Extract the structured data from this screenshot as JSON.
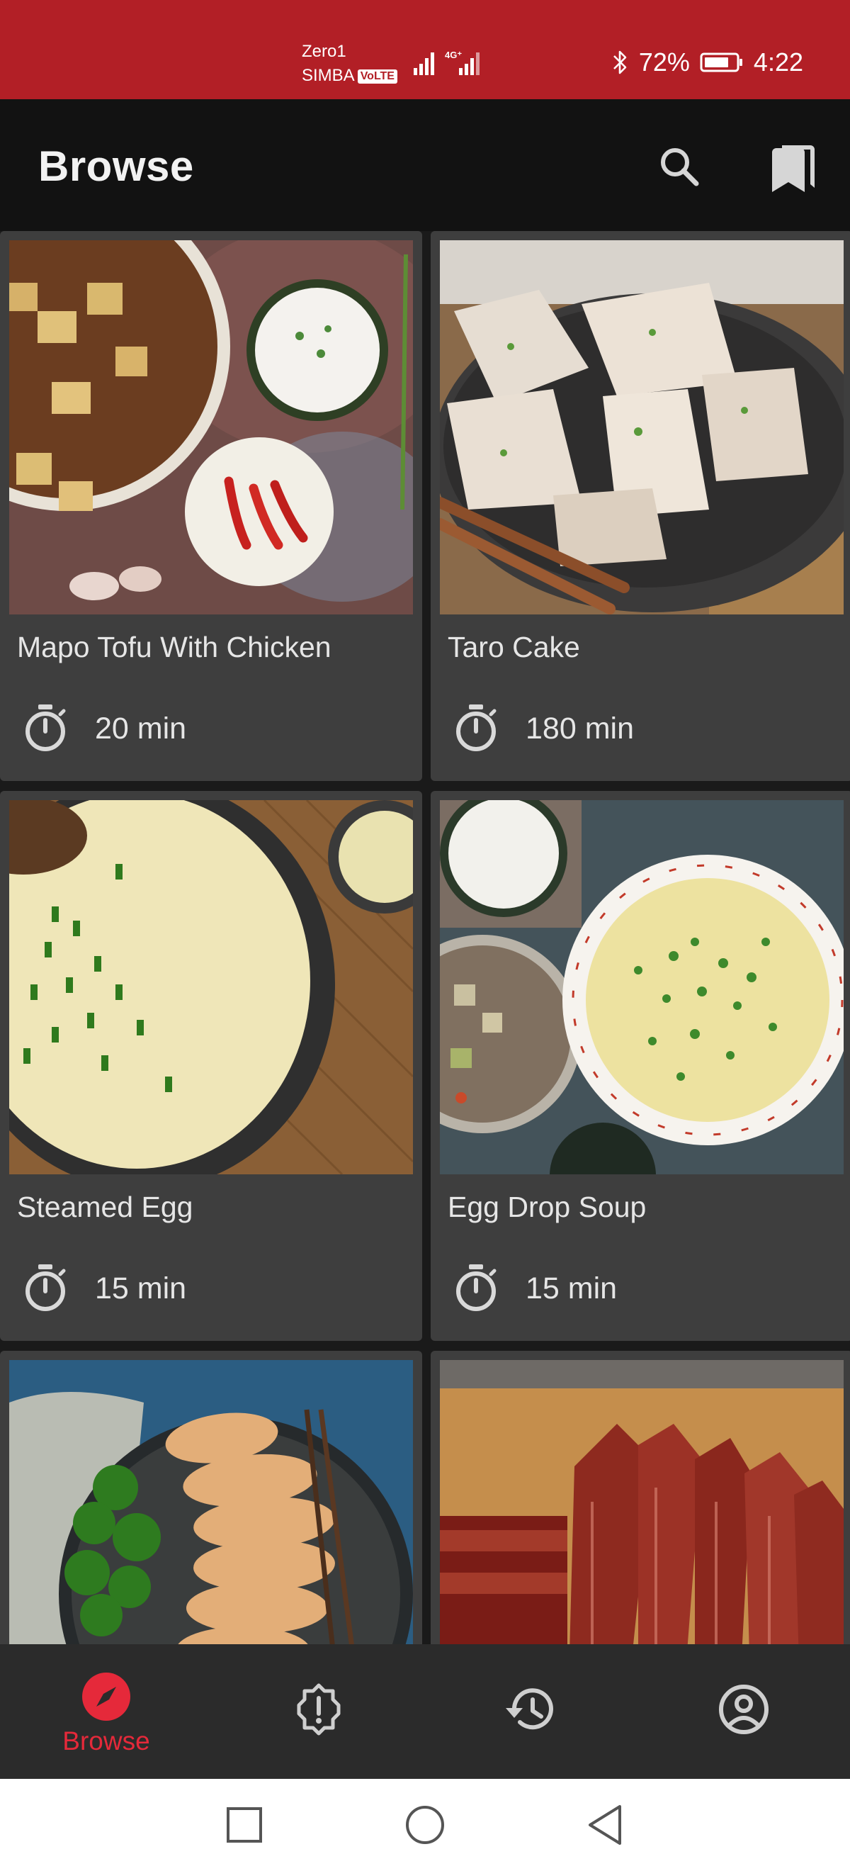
{
  "status_bar": {
    "carrier_line1": "Zero1",
    "carrier_line2": "SIMBA",
    "volte": "VoLTE",
    "network": "4G⁺",
    "battery": "72%",
    "time": "4:22",
    "bg_color": "#b21f26"
  },
  "app_bar": {
    "title": "Browse",
    "search_icon": "search-icon",
    "bookmarks_icon": "bookmarks-icon"
  },
  "recipes": [
    {
      "name": "Mapo Tofu With Chicken",
      "time": "20 min"
    },
    {
      "name": "Taro Cake",
      "time": "180 min"
    },
    {
      "name": "Steamed Egg",
      "time": "15 min"
    },
    {
      "name": "Egg Drop Soup",
      "time": "15 min"
    },
    {
      "name": "",
      "time": ""
    },
    {
      "name": "",
      "time": ""
    }
  ],
  "bottom_nav": {
    "items": [
      {
        "label": "Browse",
        "icon": "compass-icon",
        "active": true
      },
      {
        "label": "",
        "icon": "alert-badge-icon",
        "active": false
      },
      {
        "label": "",
        "icon": "history-icon",
        "active": false
      },
      {
        "label": "",
        "icon": "account-circle-icon",
        "active": false
      }
    ],
    "accent_color": "#e5293a"
  },
  "system_nav": {
    "icons": [
      "recent-apps-icon",
      "home-icon",
      "back-icon"
    ]
  }
}
